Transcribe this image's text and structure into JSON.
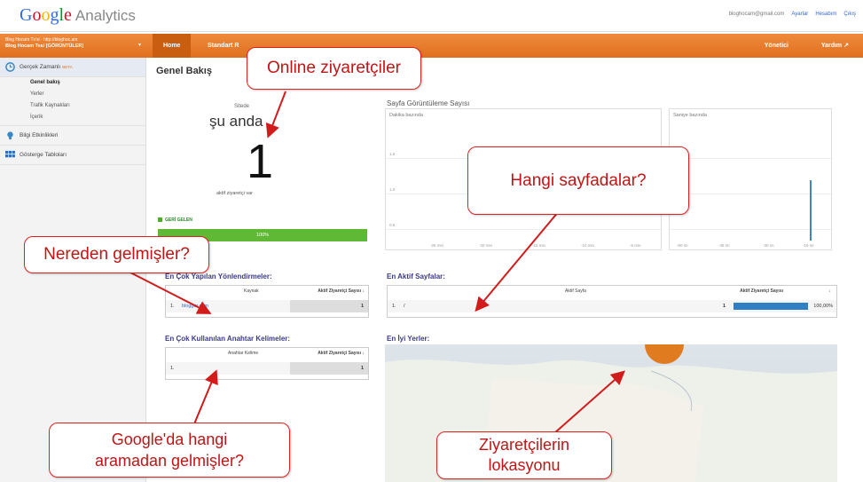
{
  "header": {
    "logo_parts": [
      "G",
      "o",
      "o",
      "g",
      "l",
      "e"
    ],
    "logo_product": "Analytics",
    "user_email": "bloghocam@gmail.com",
    "settings_link": "Ayarlar",
    "account_link": "Hesabım",
    "logout_link": "Çıkış"
  },
  "nav": {
    "account_line1": "Blog Hocam Tv'si · http://bloghoc.am",
    "account_line2": "Blog Hocam Tesi [GÖRÜNTÜLER]",
    "tabs": [
      "Home",
      "Standart R"
    ],
    "admin": "Yönetici",
    "help": "Yardım"
  },
  "sidebar": {
    "realtime": "Gerçek Zamanlı",
    "realtime_badge": "BETA",
    "sub_items": [
      "Genel bakış",
      "Yerler",
      "Trafik Kaynakları",
      "İçerik"
    ],
    "intel": "Bilgi Etkinlikleri",
    "dashboards": "Gösterge Tabloları"
  },
  "main": {
    "title": "Genel Bakış",
    "site_label": "Sitede",
    "now_label": "şu anda",
    "active_count": "1",
    "active_text": "aktif ziyaretçi var",
    "returning_label": "GERİ GELEN",
    "returning_pct": "100%",
    "pageviews_title": "Sayfa Görüntüleme Sayısı",
    "per_minute": "Dakika bazında",
    "per_second": "Saniye bazında",
    "y_ticks": [
      "1.5",
      "1.0",
      "0.5"
    ],
    "x_ticks_min": [
      "-25 min",
      "-20 min",
      "-15 min",
      "-10 min",
      "-5 min"
    ],
    "x_ticks_sec": [
      "-60 sn",
      "-45 sn",
      "-30 sn",
      "-15 sn"
    ]
  },
  "referrals": {
    "title": "En Çok Yapılan Yönlendirmeler:",
    "col_source": "Kaynak",
    "col_visitors": "Aktif Ziyaretçi Sayısı ↓",
    "rows": [
      {
        "idx": "1.",
        "source": "blogger.com",
        "count": "1"
      }
    ]
  },
  "keywords": {
    "title": "En Çok Kullanılan Anahtar Kelimeler:",
    "col_keyword": "Anahtar Kelime",
    "col_visitors": "Aktif Ziyaretçi Sayısı ↓",
    "rows": [
      {
        "idx": "1.",
        "keyword": "",
        "count": "1"
      }
    ]
  },
  "pages": {
    "title": "En Aktif Sayfalar:",
    "col_page": "Aktif Sayfa",
    "col_visitors": "Aktif Ziyaretçi Sayısı",
    "sort_icon": "↓",
    "rows": [
      {
        "idx": "1.",
        "page": "/",
        "count": "1",
        "pct": "100,00%",
        "pct_value": 1.0
      }
    ]
  },
  "locations": {
    "title": "En İyi Yerler:"
  },
  "callouts": {
    "online": "Online ziyaretçiler",
    "pages": "Hangi sayfadalar?",
    "source": "Nereden gelmişler?",
    "search": "Google'da hangi aramadan gelmişler?",
    "search_line1": "Google'da hangi",
    "search_line2": "aramadan gelmişler?",
    "location_line1": "Ziyaretçilerin",
    "location_line2": "lokasyonu"
  },
  "colors": {
    "orange": "#e0701f",
    "callout_red": "#c01515",
    "bar_blue": "#2f7fc4",
    "returning_green": "#5fb934"
  }
}
